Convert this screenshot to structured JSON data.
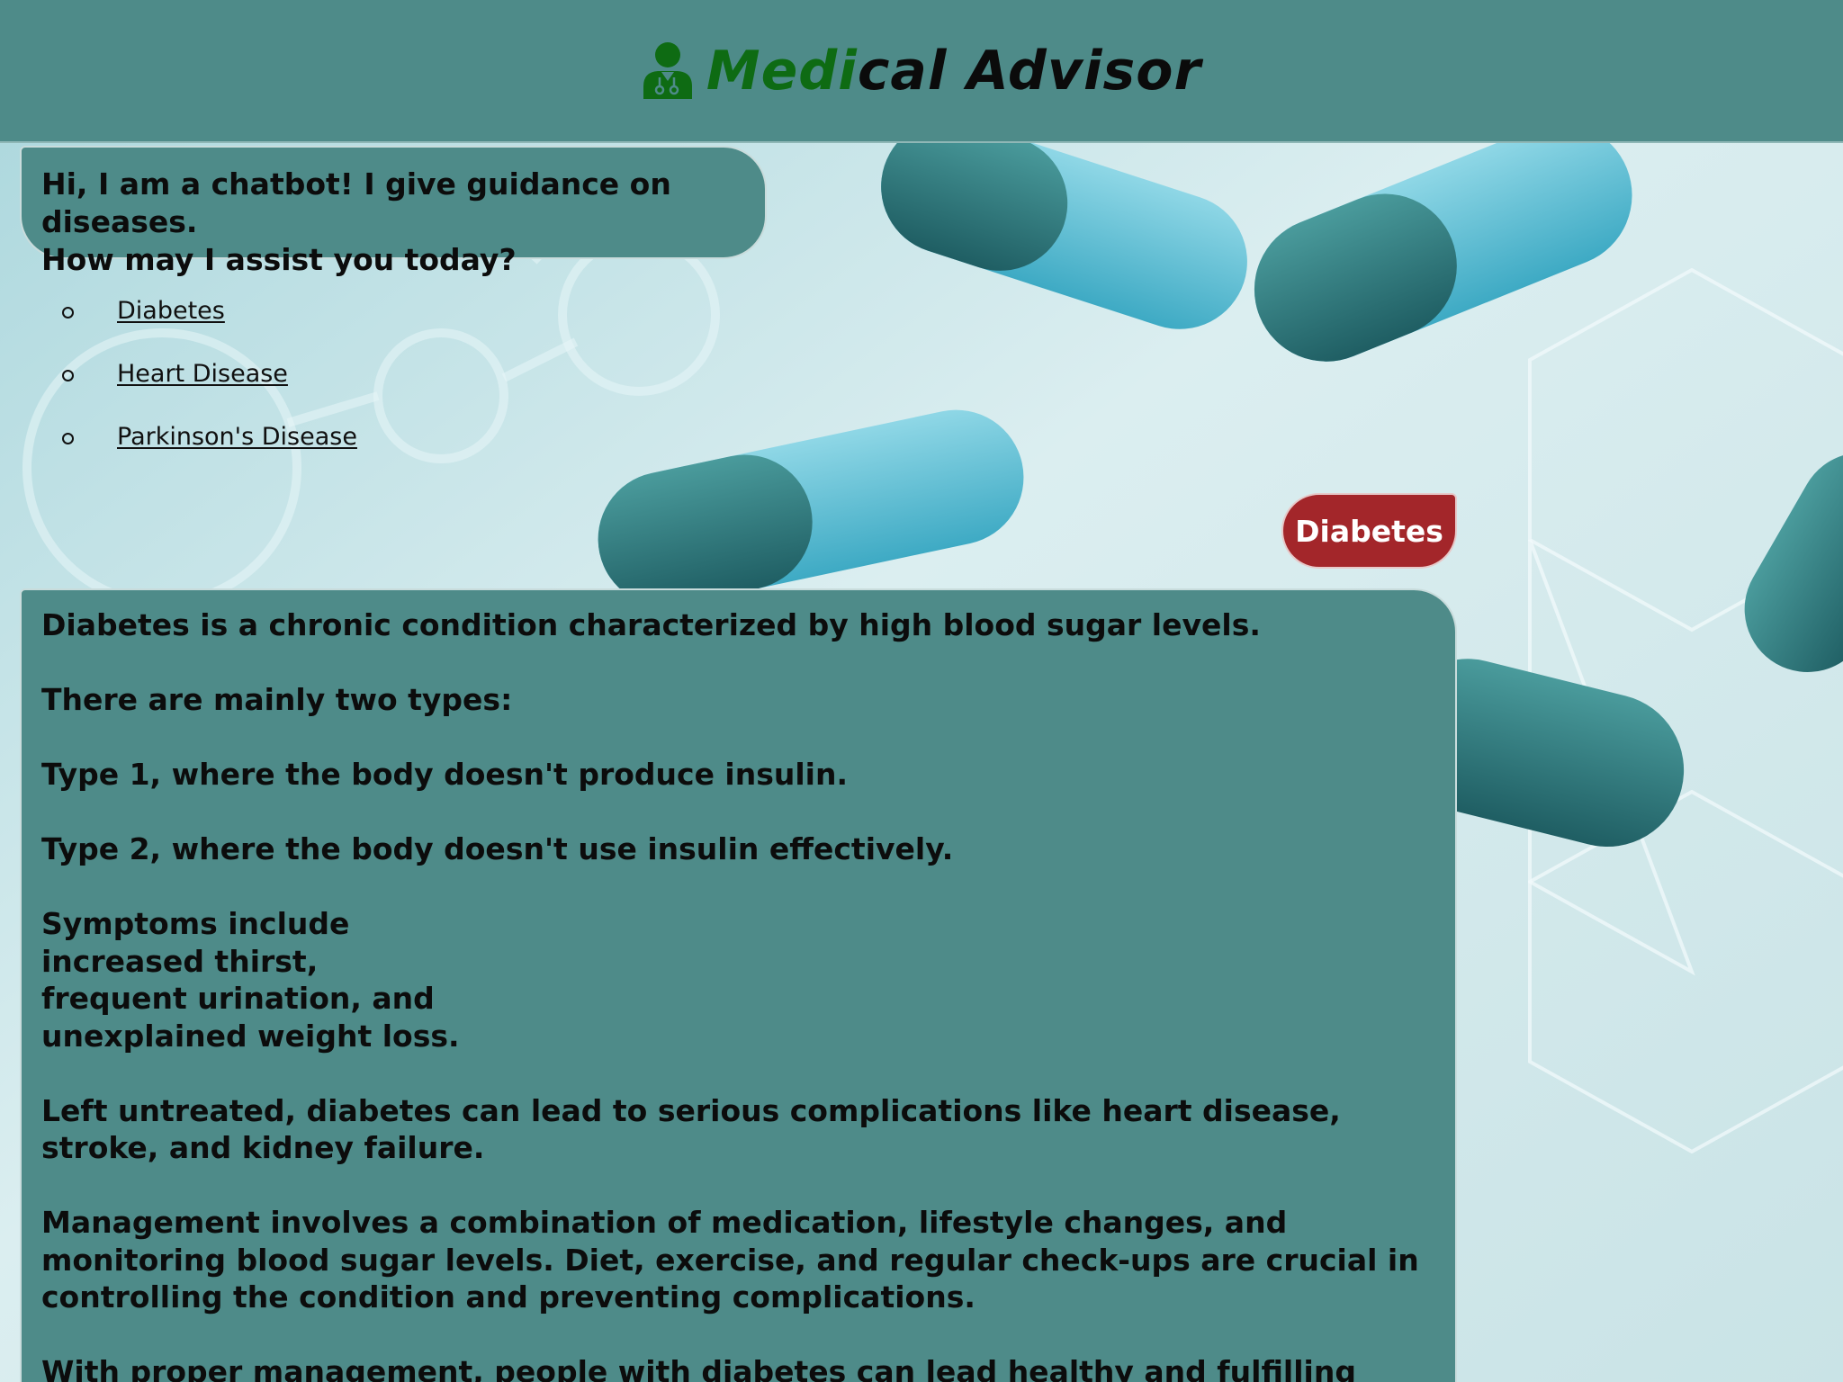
{
  "header": {
    "title_accent": "Medi",
    "title_rest": "cal Advisor",
    "logo_icon": "doctor-icon"
  },
  "chat": {
    "greeting_lines": [
      "Hi, I am a chatbot! I give guidance on diseases.",
      "How may I assist you today?"
    ],
    "options": [
      "Diabetes",
      "Heart Disease",
      "Parkinson's Disease"
    ],
    "user_message": "Diabetes",
    "answer": {
      "intro": "Diabetes is a chronic condition characterized by high blood sugar levels.",
      "types_heading": "There are mainly two types:",
      "type1": "Type 1, where the body doesn't produce insulin.",
      "type2": "Type 2, where the body doesn't use insulin effectively.",
      "symptoms": [
        "Symptoms include",
        "increased thirst,",
        "frequent urination, and",
        "unexplained weight loss."
      ],
      "complications": "Left untreated, diabetes can lead to serious complications like heart disease, stroke, and kidney failure.",
      "management": "Management involves a combination of medication, lifestyle changes, and monitoring blood sugar levels. Diet, exercise, and regular check-ups are crucial in controlling the condition and preventing complications.",
      "outlook": "With proper management, people with diabetes can lead healthy and fulfilling lives."
    }
  },
  "colors": {
    "header_bg": "#4e8b89",
    "bubble_bg": "#4e8b89",
    "user_bubble_bg": "#a3262a",
    "accent_green": "#0e6b13"
  }
}
